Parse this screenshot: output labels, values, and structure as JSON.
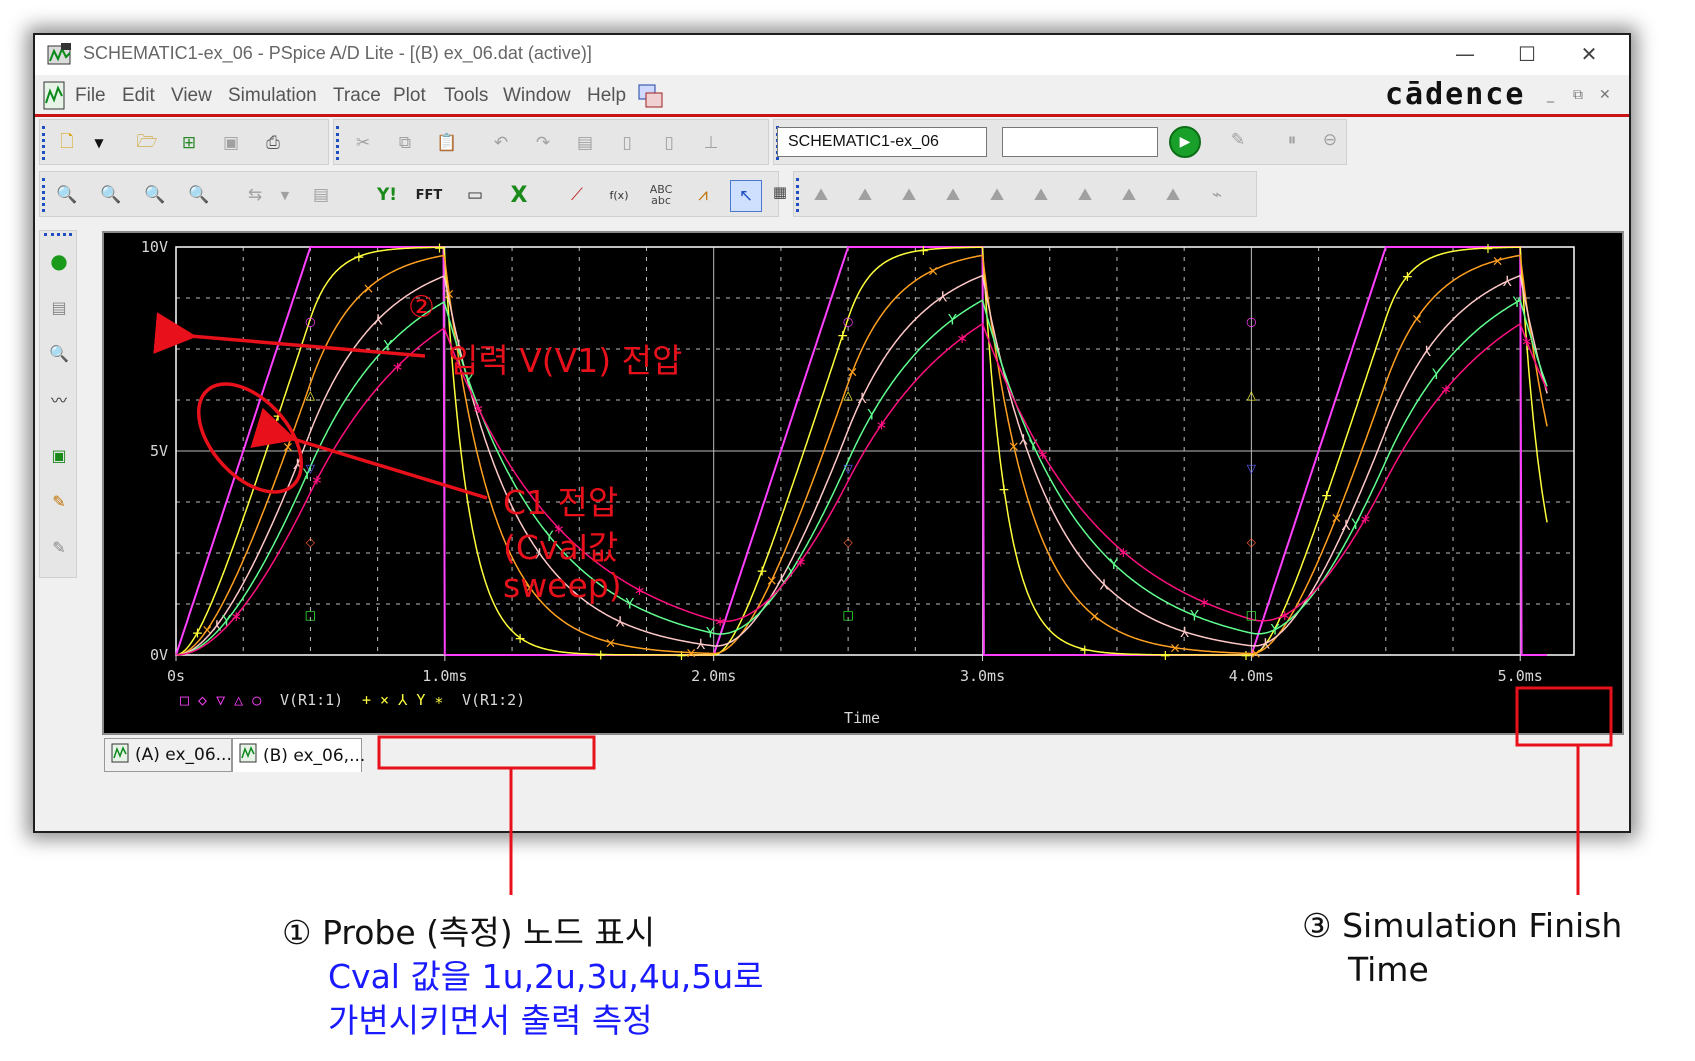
{
  "window": {
    "title": "SCHEMATIC1-ex_06 - PSpice A/D Lite - [(B) ex_06.dat (active)]",
    "minimize_glyph": "—",
    "maximize_glyph": "☐",
    "close_glyph": "✕"
  },
  "menubar": {
    "items": [
      "File",
      "Edit",
      "View",
      "Simulation",
      "Trace",
      "Plot",
      "Tools",
      "Window",
      "Help"
    ],
    "brand": "cādence",
    "mdi_min": "_",
    "mdi_restore": "⧉",
    "mdi_close": "✕"
  },
  "toolbar": {
    "schematic_selected": "SCHEMATIC1-ex_06",
    "sim_profile_value": "",
    "yaxis_label": "Y!",
    "fft_label": "FFT",
    "abc_label": "ABC",
    "abc_sub": "abc",
    "fx_label": "f(x)"
  },
  "doc_tabs": [
    {
      "label": "(A) ex_06..."
    },
    {
      "label": "(B) ex_06,..."
    }
  ],
  "chart_data": {
    "type": "line",
    "xlabel": "Time",
    "x_ticks": [
      "0s",
      "1.0ms",
      "2.0ms",
      "3.0ms",
      "4.0ms",
      "5.0ms"
    ],
    "y_ticks": [
      "0V",
      "5V",
      "10V"
    ],
    "xlim_ms": [
      0,
      5.2
    ],
    "ylim_v": [
      0,
      10
    ],
    "grid": true,
    "input_pulse": {
      "high_v": 10,
      "low_v": 0,
      "rise_ms": 0.5,
      "on_ms": 0.5,
      "period_ms": 2.0,
      "start_ms": 0.0
    },
    "cval_uF": [
      1,
      2,
      3,
      4,
      5
    ],
    "colors": [
      "#ffff3c",
      "#ffa020",
      "#ffc8c8",
      "#60ff90",
      "#ff1080"
    ],
    "legend": [
      {
        "markers": "□ ◇ ▽ △ ○",
        "name": "V(R1:1)",
        "color": "#ff40ff"
      },
      {
        "markers": "+ × ⅄ Y ∗",
        "name": "V(R1:2)",
        "color": "#ffff3c"
      }
    ],
    "legend_placement": "bottom-left"
  },
  "annotations": {
    "label_2_num": "②",
    "label_2_text": "입력 V(V1) 전압",
    "label_c1_line1": "C1 전압",
    "label_c1_line2": "(Cval값",
    "label_c1_line3": "sweep)",
    "note1_line1": "① Probe (측정) 노드 표시",
    "note1_line2": "Cval 값을 1u,2u,3u,4u,5u로",
    "note1_line3": "가변시키면서 출력 측정",
    "note3_line1": "③ Simulation Finish",
    "note3_line2": "Time",
    "red_color": "#e8101a",
    "blue_color": "#1a1aff"
  }
}
